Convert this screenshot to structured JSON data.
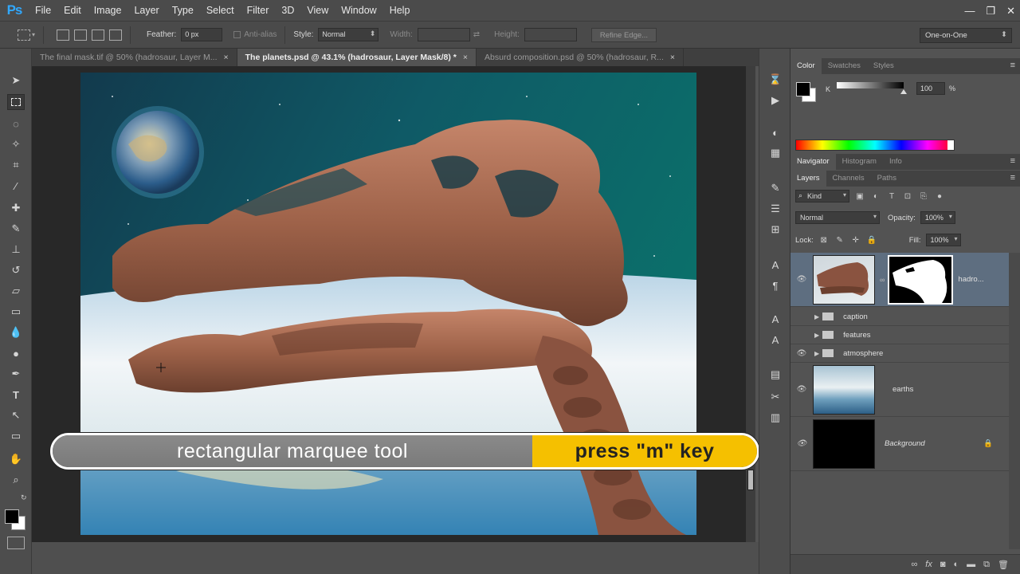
{
  "app": {
    "logo": "Ps"
  },
  "menu": [
    "File",
    "Edit",
    "Image",
    "Layer",
    "Type",
    "Select",
    "Filter",
    "3D",
    "View",
    "Window",
    "Help"
  ],
  "window_controls": {
    "minimize": "—",
    "restore": "❐",
    "close": "✕"
  },
  "options_bar": {
    "feather_label": "Feather:",
    "feather_value": "0 px",
    "antialias_label": "Anti-alias",
    "style_label": "Style:",
    "style_value": "Normal",
    "width_label": "Width:",
    "height_label": "Height:",
    "refine_edge": "Refine Edge...",
    "workspace": "One-on-One"
  },
  "tabs": [
    {
      "label": "The final mask.tif @ 50% (hadrosaur, Layer M...",
      "close": "×"
    },
    {
      "label": "The planets.psd @ 43.1% (hadrosaur, Layer Mask/8) *",
      "close": "×"
    },
    {
      "label": "Absurd composition.psd @ 50% (hadrosaur, R...",
      "close": "×"
    }
  ],
  "caption": {
    "tool_name": "rectangular marquee tool",
    "shortcut": "press \"m\" key"
  },
  "color_panel": {
    "tabs": [
      "Color",
      "Swatches",
      "Styles"
    ],
    "channel_label": "K",
    "value": "100",
    "unit": "%"
  },
  "nav_panel": {
    "tabs": [
      "Navigator",
      "Histogram",
      "Info"
    ]
  },
  "layers_panel": {
    "tabs": [
      "Layers",
      "Channels",
      "Paths"
    ],
    "filter": "Kind",
    "blend_mode": "Normal",
    "opacity_label": "Opacity:",
    "opacity": "100%",
    "lock_label": "Lock:",
    "fill_label": "Fill:",
    "fill": "100%",
    "layers": [
      {
        "name": "hadro...",
        "type": "masked",
        "visible": true
      },
      {
        "name": "caption",
        "type": "group",
        "visible": false
      },
      {
        "name": "features",
        "type": "group",
        "visible": false
      },
      {
        "name": "atmosphere",
        "type": "group",
        "visible": true
      },
      {
        "name": "earths",
        "type": "image",
        "visible": true
      },
      {
        "name": "Background",
        "type": "locked",
        "visible": true
      }
    ]
  },
  "colors": {
    "accent_yellow": "#f5c000",
    "ps_blue": "#31a8ff"
  }
}
